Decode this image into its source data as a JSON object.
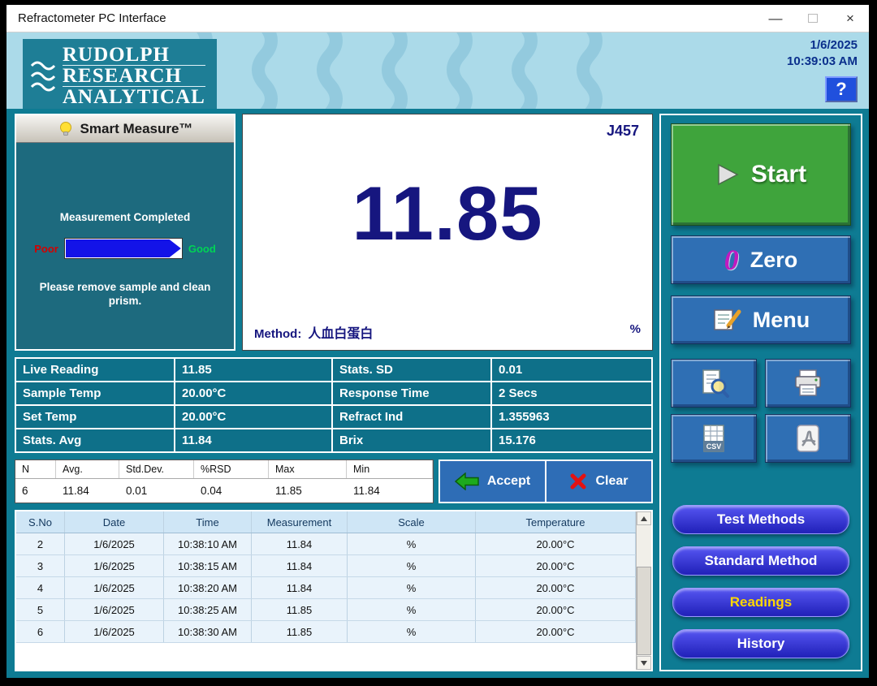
{
  "window": {
    "title": "Refractometer PC Interface",
    "minimize_glyph": "—",
    "close_glyph": "×"
  },
  "header": {
    "logo_line1": "RUDOLPH",
    "logo_line2": "RESEARCH",
    "logo_line3": "ANALYTICAL",
    "date": "1/6/2025",
    "time": "10:39:03 AM",
    "help_label": "?"
  },
  "smart_measure": {
    "title": "Smart Measure™",
    "status": "Measurement Completed",
    "poor": "Poor",
    "good": "Good",
    "instruction": "Please remove sample and clean prism."
  },
  "display": {
    "model": "J457",
    "reading": "11.85",
    "method_label": "Method:",
    "method_value": "人血白蛋白",
    "unit": "%"
  },
  "stats": {
    "rows": [
      {
        "label1": "Live Reading",
        "value1": "11.85",
        "label2": "Stats. SD",
        "value2": "0.01"
      },
      {
        "label1": "Sample Temp",
        "value1": "20.00°C",
        "label2": "Response Time",
        "value2": "2 Secs"
      },
      {
        "label1": "Set Temp",
        "value1": "20.00°C",
        "label2": "Refract Ind",
        "value2": "1.355963"
      },
      {
        "label1": "Stats. Avg",
        "value1": "11.84",
        "label2": "Brix",
        "value2": "15.176"
      }
    ]
  },
  "summary": {
    "headers": [
      "N",
      "Avg.",
      "Std.Dev.",
      "%RSD",
      "Max",
      "Min"
    ],
    "values": [
      "6",
      "11.84",
      "0.01",
      "0.04",
      "11.85",
      "11.84"
    ]
  },
  "actions": {
    "accept_label": "Accept",
    "clear_label": "Clear"
  },
  "readings": {
    "columns": [
      "S.No",
      "Date",
      "Time",
      "Measurement",
      "Scale",
      "Temperature"
    ],
    "rows": [
      [
        "2",
        "1/6/2025",
        "10:38:10 AM",
        "11.84",
        "%",
        "20.00°C"
      ],
      [
        "3",
        "1/6/2025",
        "10:38:15 AM",
        "11.84",
        "%",
        "20.00°C"
      ],
      [
        "4",
        "1/6/2025",
        "10:38:20 AM",
        "11.84",
        "%",
        "20.00°C"
      ],
      [
        "5",
        "1/6/2025",
        "10:38:25 AM",
        "11.85",
        "%",
        "20.00°C"
      ],
      [
        "6",
        "1/6/2025",
        "10:38:30 AM",
        "11.85",
        "%",
        "20.00°C"
      ]
    ]
  },
  "sidebar": {
    "start_label": "Start",
    "zero_label": "Zero",
    "zero_glyph": "0",
    "menu_label": "Menu",
    "nav": [
      {
        "label": "Test Methods",
        "active": false
      },
      {
        "label": "Standard Method",
        "active": false
      },
      {
        "label": "Readings",
        "active": true
      },
      {
        "label": "History",
        "active": false
      }
    ]
  },
  "icons": {
    "help": "question-mark-icon",
    "smart_measure": "lightbulb-icon",
    "start": "play-triangle-icon",
    "zero": "zero-glyph-icon",
    "menu": "notepad-pencil-icon",
    "preview": "document-magnifier-icon",
    "print": "printer-icon",
    "csv": "csv-file-icon",
    "pdf": "pdf-file-icon",
    "accept": "green-left-arrow-icon",
    "clear": "red-x-icon"
  },
  "colors": {
    "background_teal": "#0e7b93",
    "panel_teal": "#1d6a7e",
    "table_teal": "#0e7089",
    "banner_blue": "#abdae9",
    "start_green": "#3fa43c",
    "button_blue": "#2f6fb4",
    "actions_strip_blue": "#2e6db6",
    "nav_gradient_blue": "#3a3ae0",
    "active_nav_text": "#ffd700",
    "reading_navy": "#16167f",
    "quality_bar_blue": "#1313e8",
    "datetime_navy": "#0a2f8c"
  }
}
